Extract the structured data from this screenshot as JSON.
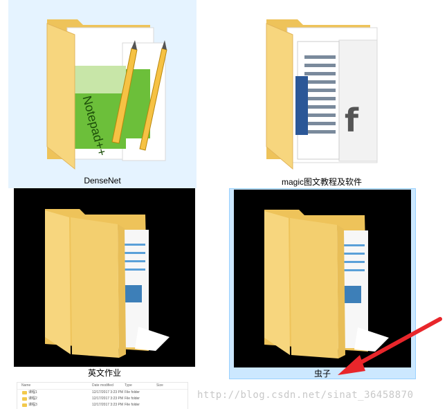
{
  "folders": [
    {
      "name": "DenseNet",
      "selected": "hover"
    },
    {
      "name": "magic图文教程及软件",
      "selected": "none"
    },
    {
      "name": "英文作业",
      "selected": "none"
    },
    {
      "name": "虫子",
      "selected": "selected"
    }
  ],
  "mini_explorer": {
    "columns": [
      "Name",
      "Date modified",
      "Type",
      "Size"
    ],
    "rows": [
      {
        "name": "课程1",
        "date": "12/17/2017 3:23 PM",
        "type": "File folder"
      },
      {
        "name": "课程2",
        "date": "12/17/2017 3:23 PM",
        "type": "File folder"
      },
      {
        "name": "课程3",
        "date": "12/17/2017 3:23 PM",
        "type": "File folder"
      }
    ]
  },
  "watermark": "http://blog.csdn.net/sinat_36458870",
  "colors": {
    "folder_front": "#f7d67e",
    "folder_back": "#eec35a",
    "hover_bg": "#e5f3ff",
    "selected_bg": "#cce8ff",
    "selected_border": "#99d1ff",
    "arrow": "#e8262b"
  }
}
